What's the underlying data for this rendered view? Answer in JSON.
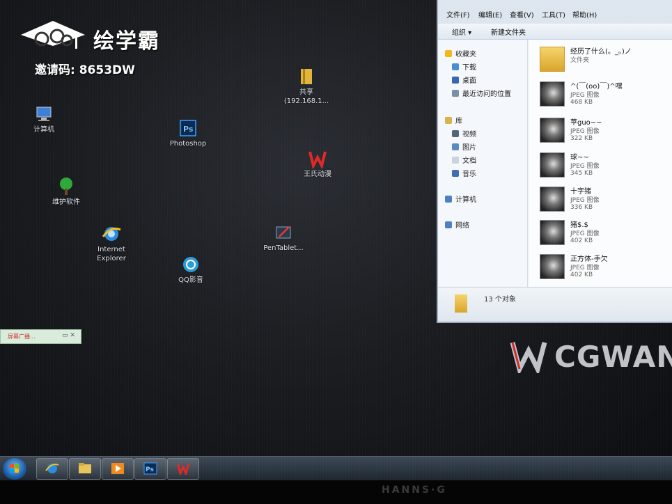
{
  "watermark": {
    "name": "绘学霸",
    "invite_code": "邀请码: 8653DW"
  },
  "desktop_icons": [
    {
      "label": "计算机",
      "icon": "computer-icon"
    },
    {
      "label": "维护软件",
      "icon": "tree-icon"
    },
    {
      "label": "Internet\nExplorer",
      "icon": "ie-icon"
    },
    {
      "label": "Photoshop",
      "icon": "photoshop-icon"
    },
    {
      "label": "QQ影音",
      "icon": "qq-player-icon"
    },
    {
      "label": "共享\n(192.168.1...",
      "icon": "shared-folder-icon"
    },
    {
      "label": "王氏动漫",
      "icon": "w-logo-icon"
    },
    {
      "label": "PenTablet...",
      "icon": "pentablet-icon"
    }
  ],
  "notification": {
    "text": "屏幕广播...",
    "buttons": "▭ ✕"
  },
  "explorer": {
    "menu": [
      "文件(F)",
      "编辑(E)",
      "查看(V)",
      "工具(T)",
      "帮助(H)"
    ],
    "toolbar": {
      "organize": "组织 ▾",
      "new_folder": "新建文件夹"
    },
    "nav": {
      "favorites": "收藏夹",
      "downloads": "下载",
      "desktop": "桌面",
      "recent": "最近访问的位置",
      "libraries": "库",
      "videos": "视频",
      "pictures": "图片",
      "documents": "文档",
      "music": "音乐",
      "computer": "计算机",
      "network": "网络"
    },
    "files": [
      {
        "name": "经历了什么(。_。)ノ",
        "type": "文件夹",
        "size": ""
      },
      {
        "name": "^(￣(oo)￣)^嘿",
        "type": "JPEG 图像",
        "size": "468 KB"
      },
      {
        "name": "苹guo~~",
        "type": "JPEG 图像",
        "size": "322 KB"
      },
      {
        "name": "球~~",
        "type": "JPEG 图像",
        "size": "345 KB"
      },
      {
        "name": "十字猪",
        "type": "JPEG 图像",
        "size": "336 KB"
      },
      {
        "name": "猪$.$",
        "type": "JPEG 图像",
        "size": "402 KB"
      },
      {
        "name": "正方体-手欠",
        "type": "JPEG 图像",
        "size": "402 KB"
      }
    ],
    "status": "13 个对象"
  },
  "branding": {
    "cg": "CGWAN"
  },
  "monitor": {
    "brand": "HANNS·G"
  },
  "colors": {
    "taskbar": "#1d252e",
    "explorer_bg": "#ecf0f4",
    "desktop": "#1a1c20"
  }
}
